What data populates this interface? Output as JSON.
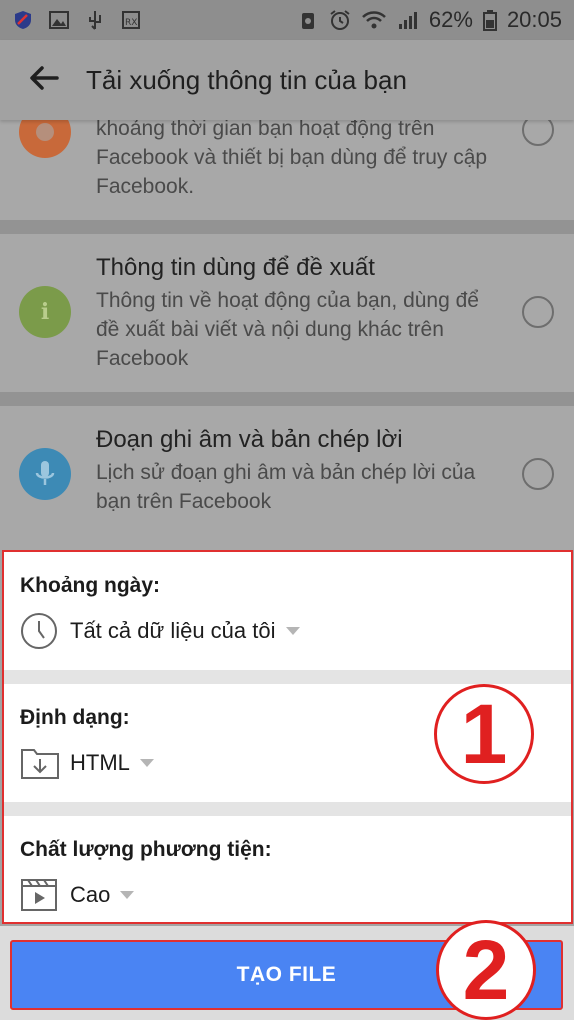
{
  "status_bar": {
    "battery": "62%",
    "time": "20:05"
  },
  "header": {
    "title": "Tải xuống thông tin của bạn"
  },
  "categories": [
    {
      "title": "",
      "description": "khoảng thời gian bạn hoạt động trên Facebook và thiết bị bạn dùng để truy cập Facebook.",
      "icon": "location-icon",
      "color": "#e8743b"
    },
    {
      "title": "Thông tin dùng để đề xuất",
      "description": "Thông tin về hoạt động của bạn, dùng để đề xuất bài viết và nội dung khác trên Facebook",
      "icon": "info-icon",
      "color": "#7aa63c",
      "icon_text": "i"
    },
    {
      "title": "Đoạn ghi âm và bản chép lời",
      "description": "Lịch sử đoạn ghi âm và bản chép lời của bạn trên Facebook",
      "icon": "microphone-icon",
      "color": "#2b9ed6"
    }
  ],
  "options": {
    "date_range": {
      "label": "Khoảng ngày:",
      "value": "Tất cả dữ liệu của tôi"
    },
    "format": {
      "label": "Định dạng:",
      "value": "HTML"
    },
    "media_quality": {
      "label": "Chất lượng phương tiện:",
      "value": "Cao"
    }
  },
  "annotations": {
    "first": "1",
    "second": "2"
  },
  "create_button": {
    "label": "TẠO FILE"
  },
  "colors": {
    "button": "#4a84f3",
    "highlight": "#e03030"
  }
}
